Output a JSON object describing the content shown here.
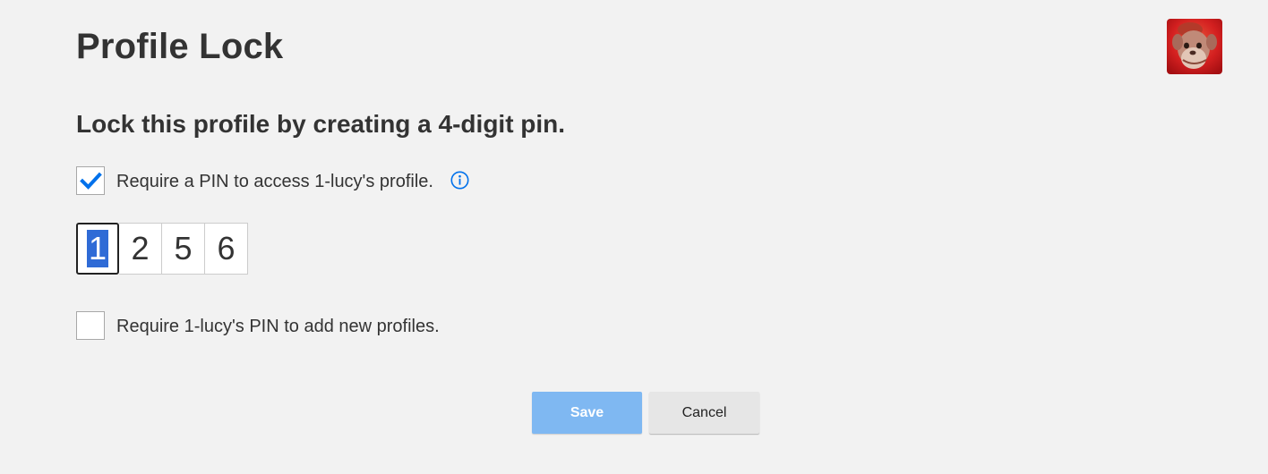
{
  "page": {
    "title": "Profile Lock",
    "subtitle": "Lock this profile by creating a 4-digit pin."
  },
  "avatar": {
    "icon": "profile-avatar-icon"
  },
  "options": {
    "require_pin_label": "Require a PIN to access 1-lucy's profile.",
    "require_pin_checked": true,
    "require_new_profile_label": "Require 1-lucy's PIN to add new profiles.",
    "require_new_profile_checked": false,
    "info_icon": "info-icon"
  },
  "pin": {
    "digits": [
      "1",
      "2",
      "5",
      "6"
    ]
  },
  "buttons": {
    "save_label": "Save",
    "cancel_label": "Cancel"
  },
  "colors": {
    "background": "#f2f2f2",
    "checkmark": "#0071eb",
    "save_button": "#7fb8f2",
    "cancel_button": "#e6e6e6",
    "pin_selection": "#2f6bd6"
  }
}
